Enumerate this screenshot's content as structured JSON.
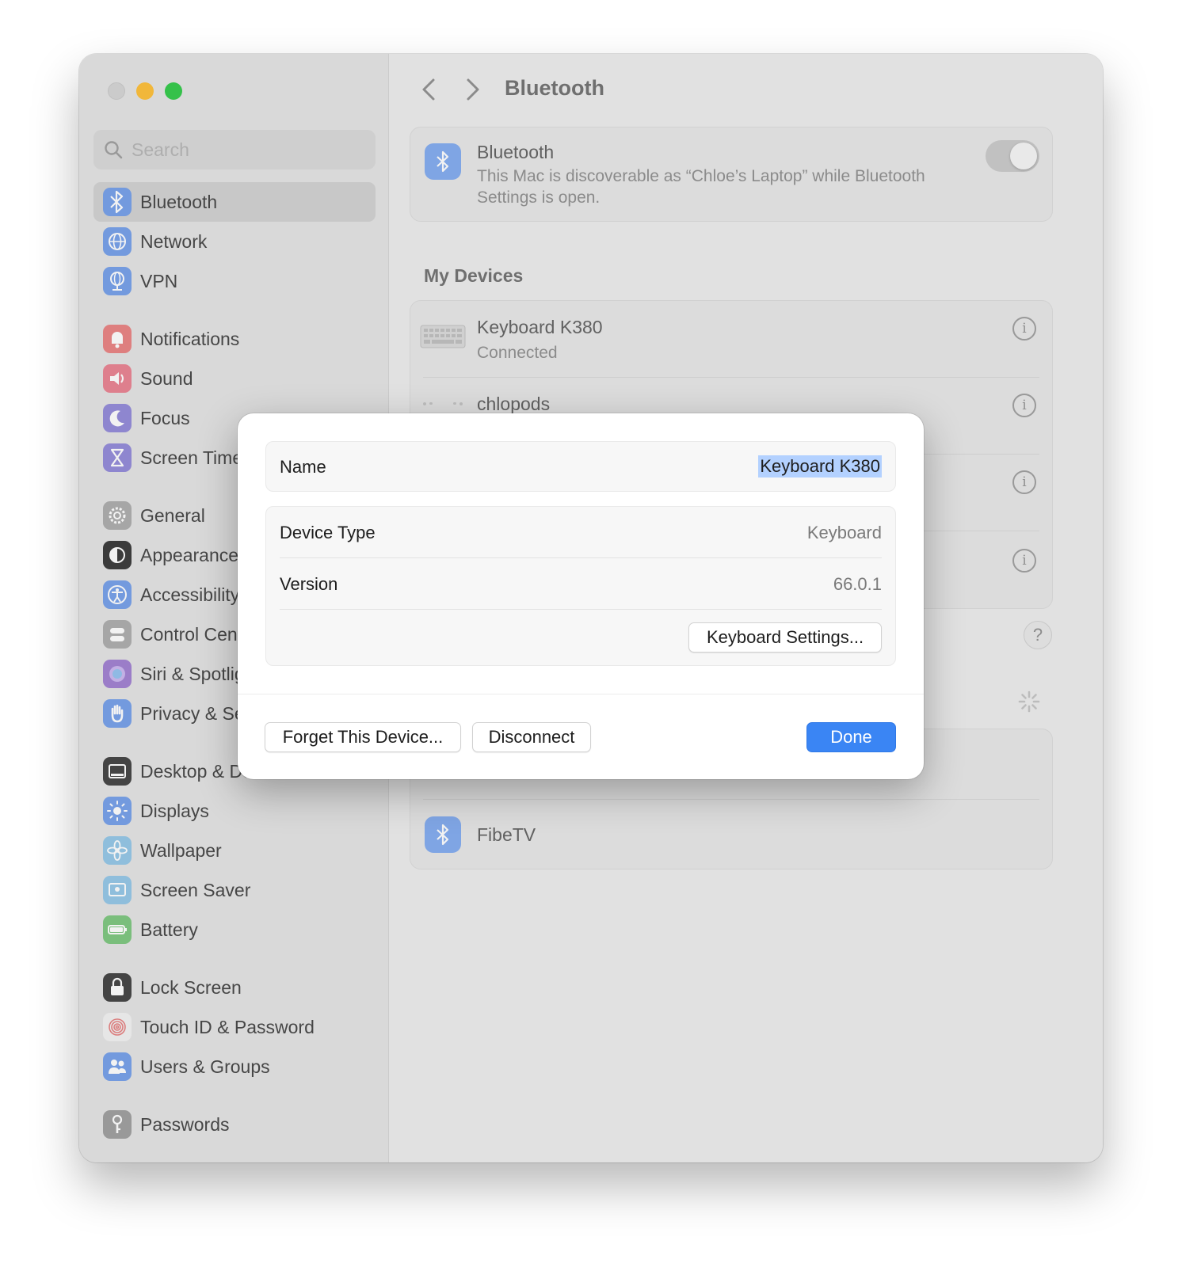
{
  "sidebar": {
    "search_placeholder": "Search",
    "groups": [
      [
        {
          "label": "Bluetooth",
          "icon": "bluetooth-icon",
          "color": "#6f9be9",
          "selected": true
        },
        {
          "label": "Network",
          "icon": "globe-icon",
          "color": "#6f9be9"
        },
        {
          "label": "VPN",
          "icon": "vpn-globe-icon",
          "color": "#6f9be9"
        }
      ],
      [
        {
          "label": "Notifications",
          "icon": "bell-icon",
          "color": "#e97d7d"
        },
        {
          "label": "Sound",
          "icon": "speaker-icon",
          "color": "#e97d8c"
        },
        {
          "label": "Focus",
          "icon": "moon-icon",
          "color": "#8e84d8"
        },
        {
          "label": "Screen Time",
          "icon": "hourglass-icon",
          "color": "#8e84d8"
        }
      ],
      [
        {
          "label": "General",
          "icon": "gear-icon",
          "color": "#a9a9a9"
        },
        {
          "label": "Appearance",
          "icon": "appearance-icon",
          "color": "#2f2f2f"
        },
        {
          "label": "Accessibility",
          "icon": "accessibility-icon",
          "color": "#6f9be9"
        },
        {
          "label": "Control Centre",
          "icon": "control-centre-icon",
          "color": "#a9a9a9"
        },
        {
          "label": "Siri & Spotlight",
          "icon": "siri-icon",
          "color": "#9d7ad0"
        },
        {
          "label": "Privacy & Security",
          "icon": "hand-icon",
          "color": "#6f9be9"
        }
      ],
      [
        {
          "label": "Desktop & Dock",
          "icon": "dock-icon",
          "color": "#3a3a3a"
        },
        {
          "label": "Displays",
          "icon": "sun-icon",
          "color": "#6f9be9"
        },
        {
          "label": "Wallpaper",
          "icon": "flower-icon",
          "color": "#8fc4e6"
        },
        {
          "label": "Screen Saver",
          "icon": "screensaver-icon",
          "color": "#8fc4e6"
        },
        {
          "label": "Battery",
          "icon": "battery-icon",
          "color": "#77c479"
        }
      ],
      [
        {
          "label": "Lock Screen",
          "icon": "lock-icon",
          "color": "#3a3a3a"
        },
        {
          "label": "Touch ID & Password",
          "icon": "fingerprint-icon",
          "color": "#f2f2f2"
        },
        {
          "label": "Users & Groups",
          "icon": "users-icon",
          "color": "#6f9be9"
        }
      ],
      [
        {
          "label": "Passwords",
          "icon": "key-icon",
          "color": "#9a9a9a"
        }
      ]
    ]
  },
  "header": {
    "title": "Bluetooth"
  },
  "bluetooth_card": {
    "title": "Bluetooth",
    "subtitle_line1": "This Mac is discoverable as “Chloe’s Laptop” while Bluetooth",
    "subtitle_line2": "Settings is open."
  },
  "my_devices": {
    "heading": "My Devices",
    "items": [
      {
        "name": "Keyboard K380",
        "status": "Connected"
      },
      {
        "name": "chlopods",
        "status": ""
      }
    ]
  },
  "nearby": {
    "items": [
      {
        "name": "FibeTV"
      }
    ]
  },
  "dialog": {
    "name_label": "Name",
    "name_value": "Keyboard K380",
    "device_type_label": "Device Type",
    "device_type_value": "Keyboard",
    "version_label": "Version",
    "version_value": "66.0.1",
    "keyboard_settings_label": "Keyboard Settings...",
    "forget_label": "Forget This Device...",
    "disconnect_label": "Disconnect",
    "done_label": "Done"
  },
  "colors": {
    "accent": "#3a85f4",
    "selection": "#b3d1ff"
  }
}
